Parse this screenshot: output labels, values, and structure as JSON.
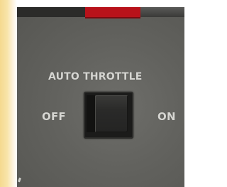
{
  "panel": {
    "title": "AUTO THROTTLE",
    "off_label": "OFF",
    "on_label": "ON",
    "switch_state": "off"
  },
  "colors": {
    "panel": "#62625e",
    "label": "#d6d6d2",
    "accent_red": "#b8121a",
    "switch": "#2a2a29"
  },
  "icons": {
    "switch": "rocker-switch"
  }
}
